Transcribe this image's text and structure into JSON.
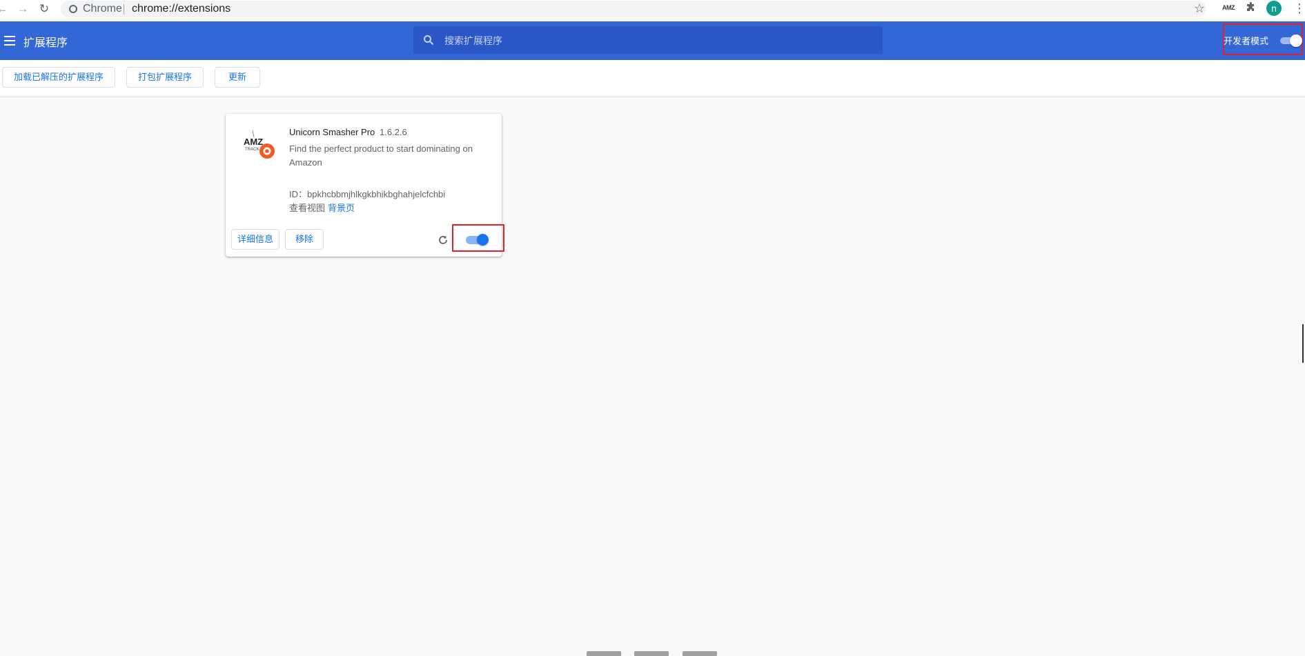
{
  "browser": {
    "site_name": "Chrome",
    "url": "chrome://extensions",
    "avatar_letter": "n",
    "toolbar_ext_label": "AMZ"
  },
  "header": {
    "title": "扩展程序",
    "search_placeholder": "搜索扩展程序",
    "dev_mode_label": "开发者模式",
    "dev_mode_enabled": true
  },
  "toolbar": {
    "load_unpacked": "加载已解压的扩展程序",
    "pack": "打包扩展程序",
    "update": "更新"
  },
  "extension": {
    "name": "Unicorn Smasher Pro",
    "version": "1.6.2.6",
    "description": "Find the perfect product to start dominating on Amazon",
    "id_text": "ID：bpkhcbbmjhlkgkbhikbghahjelcfchbi",
    "inspect_label": "查看视图",
    "background_link": "背景页",
    "details_button": "详细信息",
    "remove_button": "移除",
    "enabled": true,
    "icon_text_top": "AMZ",
    "icon_text_bottom": "TRACK"
  },
  "colors": {
    "header_bg": "#3367d6",
    "accent": "#1a73e8",
    "highlight_border": "#e0202a"
  }
}
